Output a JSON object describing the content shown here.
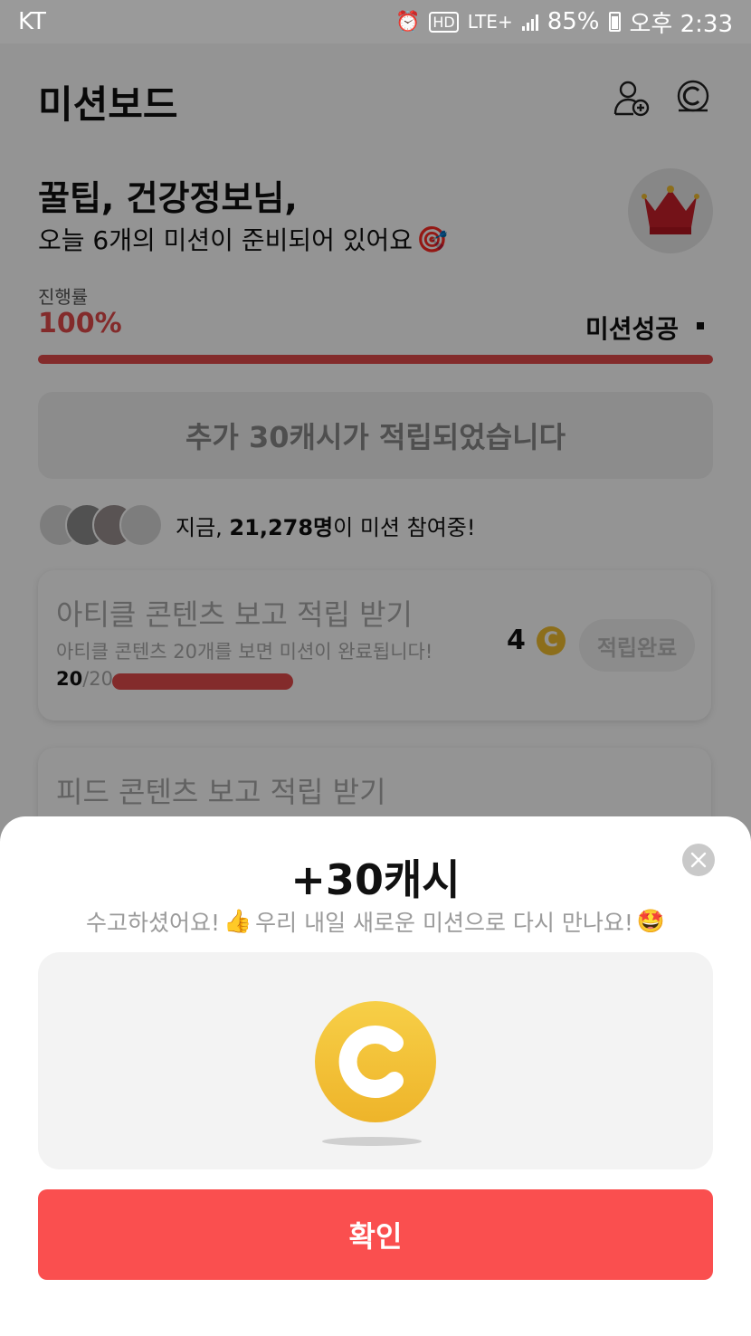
{
  "status_bar": {
    "carrier": "KT",
    "network": "LTE+",
    "battery": "85%",
    "time": "오후 2:33"
  },
  "header": {
    "title": "미션보드",
    "icons": [
      "add-user-icon",
      "coin-history-icon"
    ]
  },
  "greeting": {
    "name": "꿀팁, 건강정보님,",
    "subtitle": "오늘 6개의 미션이 준비되어 있어요",
    "subtitle_emoji": "🎯"
  },
  "progress": {
    "label": "진행률",
    "value": "100%",
    "status": "미션성공",
    "fraction": 1.0
  },
  "bonus_banner": "추가 30캐시가 적립되었습니다",
  "participants": {
    "prefix": "지금, ",
    "count": "21,278명",
    "suffix": "이 미션 참여중!"
  },
  "missions": [
    {
      "title": "아티클 콘텐츠 보고 적립 받기",
      "description": "아티클 콘텐츠 20개를 보면 미션이 완료됩니다!",
      "progress_done": "20",
      "progress_total": "/20",
      "reward": "4",
      "button": "적립완료"
    },
    {
      "title": "피드 콘텐츠 보고 적립 받기"
    }
  ],
  "modal": {
    "title": "+30캐시",
    "subtitle_part1": "수고하셨어요!",
    "subtitle_part2": " 우리 내일 새로운 미션으로 다시 만나요!",
    "emoji_thumbs": "👍",
    "emoji_star": "🤩",
    "confirm": "확인"
  },
  "colors": {
    "accent_red": "#e24a4a",
    "confirm_red": "#fa4f4f",
    "coin_yellow": "#f1bd2f"
  }
}
